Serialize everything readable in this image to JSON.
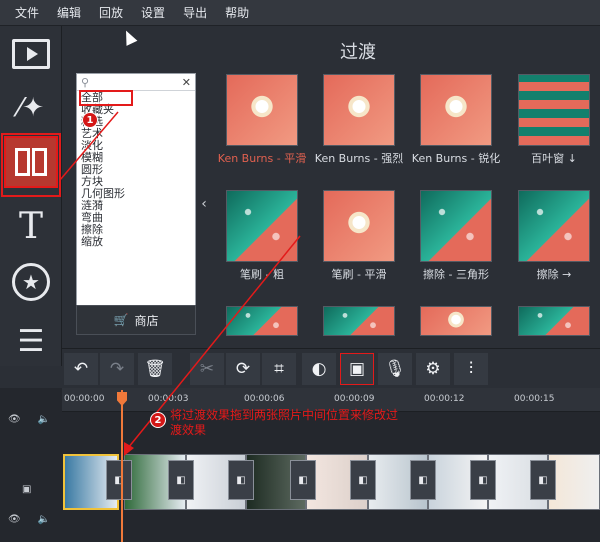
{
  "menu": [
    "文件",
    "编辑",
    "回放",
    "设置",
    "导出",
    "帮助"
  ],
  "panel": {
    "title": "过渡",
    "search_placeholder": "",
    "categories": [
      "全部",
      "收藏夹",
      "精选",
      "艺术",
      "淡化",
      "模糊",
      "圆形",
      "方块",
      "几何图形",
      "涟漪",
      "弯曲",
      "擦除",
      "缩放"
    ],
    "selected_category": "全部",
    "store_label": "商店"
  },
  "transitions": [
    {
      "label": "Ken Burns - 平滑",
      "selected": true
    },
    {
      "label": "Ken Burns - 强烈"
    },
    {
      "label": "Ken Burns - 锐化"
    },
    {
      "label": "百叶窗 ↓"
    },
    {
      "label": "笔刷 - 粗"
    },
    {
      "label": "笔刷 - 平滑"
    },
    {
      "label": "擦除 - 三角形"
    },
    {
      "label": "擦除 →"
    }
  ],
  "timeline": {
    "ticks": [
      "00:00:00",
      "00:00:03",
      "00:00:06",
      "00:00:09",
      "00:00:12",
      "00:00:15"
    ]
  },
  "annotations": {
    "step1": "1",
    "step2": "2",
    "note": "将过渡效果拖到两张照片中间位置来修改过渡效果"
  },
  "colors": {
    "accent_red": "#e31a1a",
    "playhead": "#f0793a",
    "selected_label": "#e0604f"
  }
}
